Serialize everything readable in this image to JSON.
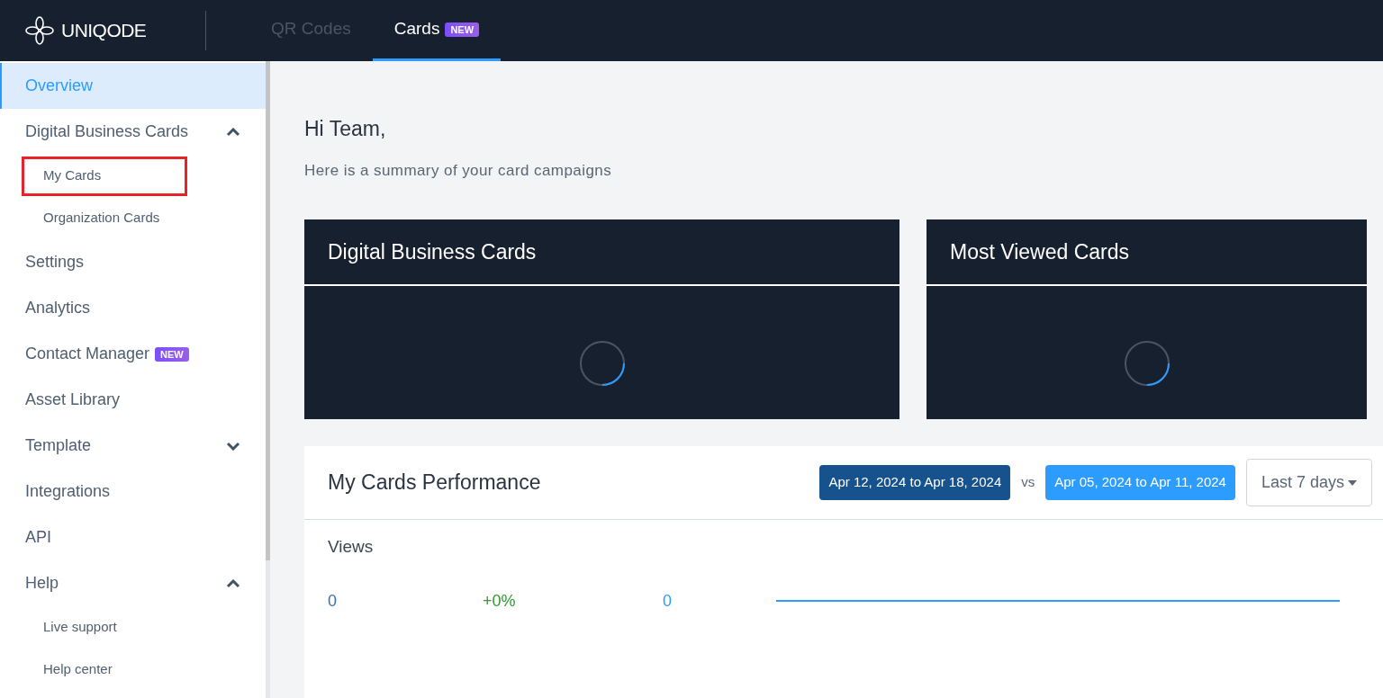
{
  "header": {
    "logo": "UNIQODE",
    "tabs": [
      {
        "label": "QR Codes",
        "selected": false
      },
      {
        "label": "Cards",
        "selected": true,
        "badge": "NEW"
      }
    ]
  },
  "sidebar": {
    "items": [
      {
        "label": "Overview",
        "selected": true
      },
      {
        "label": "Digital Business Cards",
        "selected": false,
        "expanded": true,
        "children": [
          {
            "label": "My Cards",
            "selected": false,
            "highlighted": true
          },
          {
            "label": "Organization Cards",
            "selected": false,
            "highlighted": false
          }
        ]
      },
      {
        "label": "Settings",
        "selected": false
      },
      {
        "label": "Analytics",
        "selected": false
      },
      {
        "label": "Contact Manager",
        "selected": false,
        "badge": "NEW"
      },
      {
        "label": "Asset Library",
        "selected": false
      },
      {
        "label": "Template",
        "selected": false,
        "expanded": false
      },
      {
        "label": "Integrations",
        "selected": false
      },
      {
        "label": "API",
        "selected": false
      },
      {
        "label": "Help",
        "selected": false,
        "expanded": true,
        "children": [
          {
            "label": "Live support",
            "selected": false,
            "highlighted": false
          },
          {
            "label": "Help center",
            "selected": false,
            "highlighted": false
          }
        ]
      }
    ]
  },
  "greeting": "Hi Team,",
  "subtitle": "Here is a summary of your card campaigns",
  "panels": [
    {
      "title": "Digital Business Cards",
      "loading": true
    },
    {
      "title": "Most Viewed Cards",
      "loading": true
    }
  ],
  "performance": {
    "title": "My Cards Performance",
    "current_range": "Apr 12, 2024 to Apr 18, 2024",
    "vs": "vs",
    "previous_range": "Apr 05, 2024 to Apr 11, 2024",
    "period": "Last 7 days",
    "metric": {
      "label": "Views",
      "current": "0",
      "change": "+0%",
      "previous": "0"
    }
  }
}
